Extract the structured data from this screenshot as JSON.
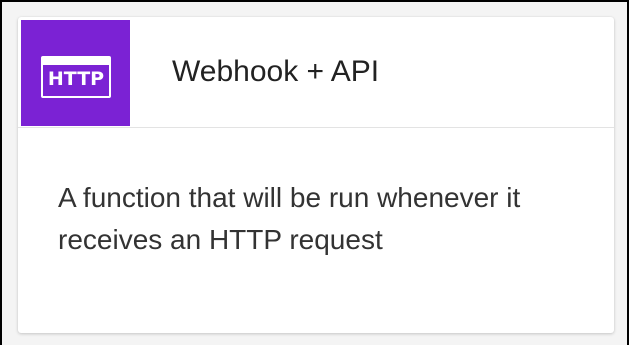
{
  "card": {
    "icon": {
      "name": "http-icon",
      "text": "HTTP",
      "background": "#7b22d4",
      "foreground": "#ffffff"
    },
    "title": "Webhook + API",
    "description": "A function that will be run whenever it receives an HTTP request"
  }
}
